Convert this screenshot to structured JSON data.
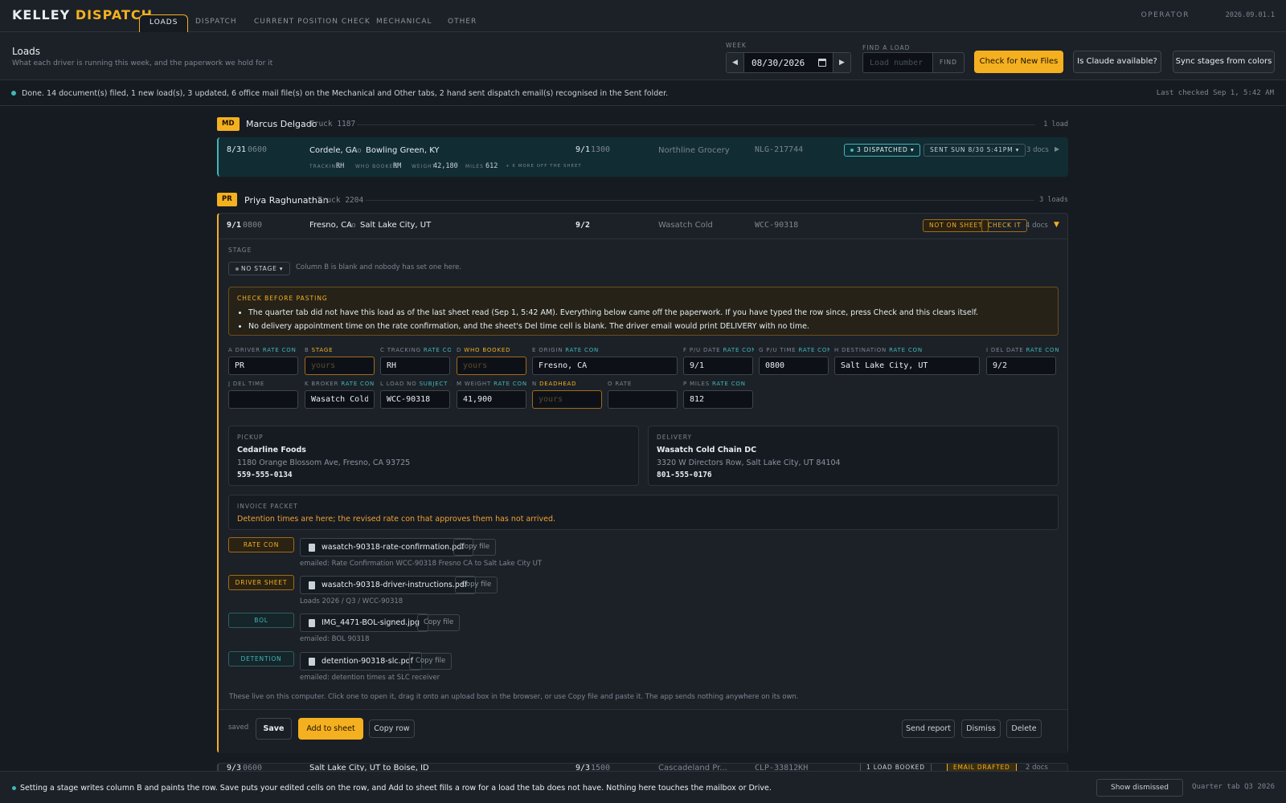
{
  "brand": {
    "name1": "KELLEY",
    "name2": "DISPATCH"
  },
  "nav": {
    "tabs": [
      "LOADS",
      "DISPATCH",
      "CURRENT POSITION CHECK",
      "MECHANICAL",
      "OTHER"
    ],
    "active": "LOADS"
  },
  "operator": "OPERATOR",
  "version": "2026.09.01.1",
  "header": {
    "title": "Loads",
    "subtitle": "What each driver is running this week, and the paperwork we hold for it",
    "week_label": "WEEK",
    "week_value": "08/30/2026",
    "find_label": "FIND A LOAD",
    "find_placeholder": "Load number",
    "find_button": "FIND",
    "btn_check": "Check for New Files",
    "btn_claude": "Is Claude available?",
    "btn_sync": "Sync stages from colors"
  },
  "status": {
    "text": "Done. 14 document(s) filed, 1 new load(s), 3 updated, 6 office mail file(s) on the Mechanical and Other tabs, 2 hand sent dispatch email(s) recognised in the Sent folder.",
    "last_checked": "Last checked Sep 1, 5:42 AM"
  },
  "drivers": [
    {
      "initials": "MD",
      "name": "Marcus Delgado",
      "truck": "Truck 1187",
      "count": "1 load",
      "loads": [
        {
          "pu_date": "8/31",
          "pu_time": "0600",
          "origin": "Cordele, GA",
          "to": "to",
          "dest": "Bowling Green, KY",
          "del_date": "9/1",
          "del_time": "1300",
          "broker": "Northline Grocery",
          "load_no": "NLG-217744",
          "stage": "3 DISPATCHED",
          "sent": "SENT SUN 8/30 5:41PM",
          "docs": "3 docs",
          "sub": {
            "tracking_lbl": "TRACKING",
            "tracking": "RH",
            "who_lbl": "WHO BOOKED",
            "who": "RM",
            "weight_lbl": "WEIGHT",
            "weight": "42,180",
            "miles_lbl": "MILES",
            "miles": "612",
            "more": "+ 6 MORE OFF THE SHEET"
          }
        }
      ]
    },
    {
      "initials": "PR",
      "name": "Priya Raghunathan",
      "truck": "Truck 2204",
      "count": "3 loads",
      "loads": [
        {
          "pu_date": "9/1",
          "pu_time": "0800",
          "origin": "Fresno, CA",
          "to": "to",
          "dest": "Salt Lake City, UT",
          "del_date": "9/2",
          "broker": "Wasatch Cold",
          "load_no": "WCC-90318",
          "badge1": "NOT ON SHEET",
          "badge2": "CHECK IT",
          "docs": "4 docs"
        }
      ]
    }
  ],
  "detail": {
    "stage_label": "STAGE",
    "stage_chip": "NO STAGE",
    "stage_note": "Column B is blank and nobody has set one here.",
    "warn_title": "CHECK BEFORE PASTING",
    "warn_items": [
      "The quarter tab did not have this load as of the last sheet read (Sep 1, 5:42 AM). Everything below came off the paperwork. If you have typed the row since, press Check and this clears itself.",
      "No delivery appointment time on the rate confirmation, and the sheet's Del time cell is blank. The driver email would print DELIVERY with no time."
    ],
    "fields": {
      "a": {
        "col": "A",
        "name": "DRIVER",
        "src": "RATE CON",
        "value": "PR"
      },
      "b": {
        "col": "B",
        "name": "STAGE",
        "placeholder": "yours"
      },
      "c": {
        "col": "C",
        "name": "TRACKING",
        "src": "RATE CON",
        "value": "RH"
      },
      "d": {
        "col": "D",
        "name": "WHO BOOKED",
        "placeholder": "yours"
      },
      "e": {
        "col": "E",
        "name": "ORIGIN",
        "src": "RATE CON",
        "value": "Fresno, CA"
      },
      "f": {
        "col": "F",
        "name": "P/U DATE",
        "src": "RATE CON",
        "value": "9/1"
      },
      "g": {
        "col": "G",
        "name": "P/U TIME",
        "src": "RATE CON",
        "value": "0800"
      },
      "h": {
        "col": "H",
        "name": "DESTINATION",
        "src": "RATE CON",
        "value": "Salt Lake City, UT"
      },
      "i": {
        "col": "I",
        "name": "DEL DATE",
        "src": "RATE CON",
        "value": "9/2"
      },
      "j": {
        "col": "J",
        "name": "DEL TIME",
        "value": ""
      },
      "k": {
        "col": "K",
        "name": "BROKER",
        "src": "RATE CON",
        "value": "Wasatch Cold"
      },
      "l": {
        "col": "L",
        "name": "LOAD NO",
        "src": "SUBJECT L",
        "value": "WCC-90318"
      },
      "m": {
        "col": "M",
        "name": "WEIGHT",
        "src": "RATE CON",
        "value": "41,900"
      },
      "n": {
        "col": "N",
        "name": "DEADHEAD",
        "placeholder": "yours"
      },
      "o": {
        "col": "O",
        "name": "RATE",
        "value": ""
      },
      "p": {
        "col": "P",
        "name": "MILES",
        "src": "RATE CON",
        "value": "812"
      }
    },
    "pickup": {
      "title": "PICKUP",
      "name": "Cedarline Foods",
      "street": "1180 Orange Blossom Ave, Fresno, CA 93725",
      "phone": "559-555-0134"
    },
    "delivery": {
      "title": "DELIVERY",
      "name": "Wasatch Cold Chain DC",
      "street": "3320 W Directors Row, Salt Lake City, UT 84104",
      "phone": "801-555-0176"
    },
    "invoice": {
      "title": "INVOICE PACKET",
      "note": "Detention times are here; the revised rate con that approves them has not arrived."
    },
    "docs": [
      {
        "tag": "RATE CON",
        "file": "wasatch-90318-rate-confirmation.pdf",
        "copy": "Copy file",
        "sub": "emailed: Rate Confirmation WCC-90318 Fresno CA to Salt Lake City UT"
      },
      {
        "tag": "DRIVER SHEET",
        "file": "wasatch-90318-driver-instructions.pdf",
        "copy": "Copy file",
        "sub": "Loads 2026 / Q3 / WCC-90318"
      },
      {
        "tag": "BOL",
        "file": "IMG_4471-BOL-signed.jpg",
        "copy": "Copy file",
        "sub": "emailed: BOL 90318"
      },
      {
        "tag": "DETENTION",
        "file": "detention-90318-slc.pdf",
        "copy": "Copy file",
        "sub": "emailed: detention times at SLC receiver"
      }
    ],
    "docs_note": "These live on this computer. Click one to open it, drag it onto an upload box in the browser, or use Copy file and paste it. The app sends nothing anywhere on its own.",
    "footer": {
      "saved": "saved",
      "save": "Save",
      "add": "Add to sheet",
      "copy_row": "Copy row",
      "send_report": "Send report",
      "dismiss": "Dismiss",
      "delete": "Delete"
    }
  },
  "row3": {
    "pu_date": "9/3",
    "pu_time": "0600",
    "route": "Salt Lake City, UT to Boise, ID",
    "del_date": "9/3",
    "del_time": "1500",
    "broker": "Cascadeland Pr...",
    "load_no": "CLP-33812KH",
    "stage": "1 LOAD BOOKED",
    "badge": "EMAIL DRAFTED",
    "docs": "2 docs"
  },
  "bottom": {
    "text": "Setting a stage writes column B and paints the row. Save puts your edited cells on the row, and Add to sheet fills a row for a load the tab does not have. Nothing here touches the mailbox or Drive.",
    "show_dismissed": "Show dismissed",
    "quarter": "Quarter tab Q3 2026"
  },
  "colors": {
    "accent": "#f5b020",
    "teal": "#3fb8b8",
    "bg": "#161b22"
  }
}
